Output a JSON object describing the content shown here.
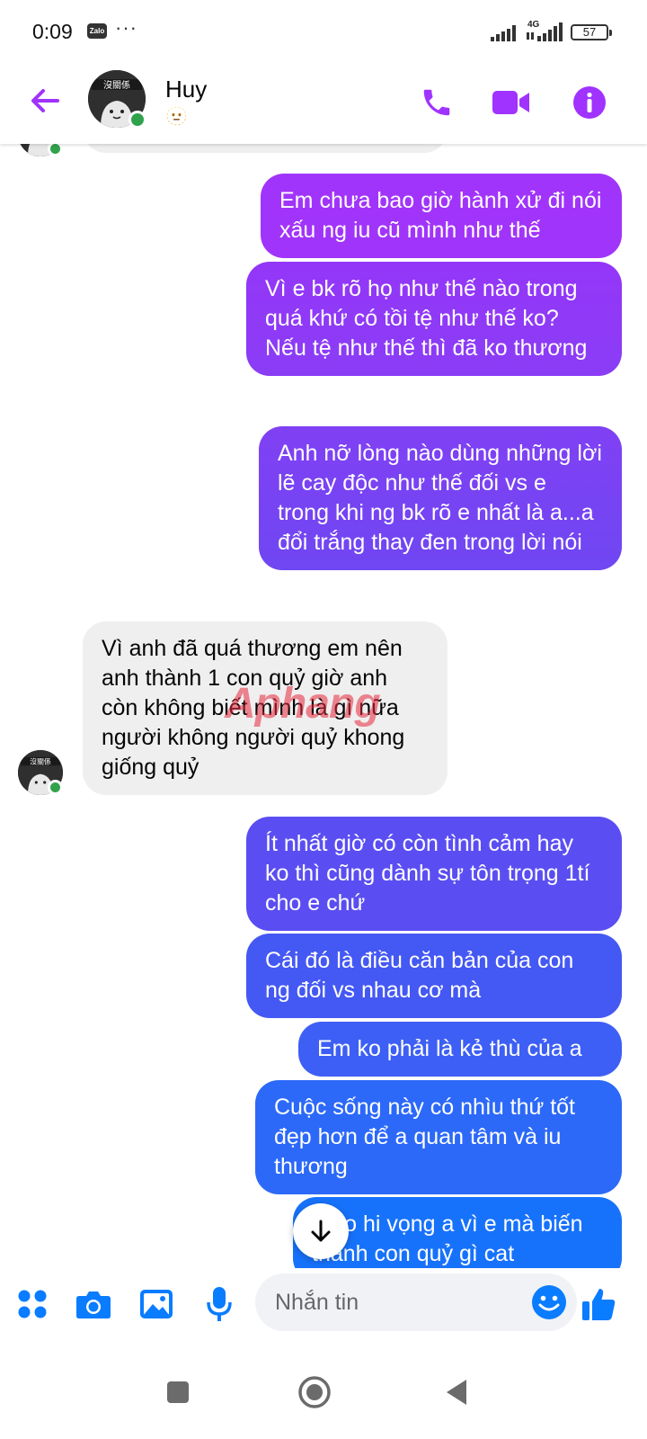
{
  "status_bar": {
    "time": "0:09",
    "app_badge": "Zalo",
    "more": "···",
    "network": "4G",
    "battery": "57"
  },
  "header": {
    "contact_name": "Huy",
    "status_emoji": "🫥"
  },
  "messages": [
    {
      "id": "m1",
      "from": "me",
      "text": "Em chưa bao giờ hành xử đi nói xấu ng iu cũ mình như thế"
    },
    {
      "id": "m2",
      "from": "me",
      "text": "Vì e bk rõ họ như thế nào trong quá khứ có tồi tệ như thế ko? Nếu tệ như thế thì đã ko thương"
    },
    {
      "id": "m3",
      "from": "me",
      "text": "Anh nỡ lòng nào dùng những lời lẽ cay độc như thế đối vs e trong khi ng bk rõ e nhất là a...a đổi trắng thay đen trong lời nói"
    },
    {
      "id": "m4",
      "from": "them",
      "text": "Vì anh đã quá thương em nên anh thành 1 con quỷ giờ anh còn không biết mình là gì nữa người không người quỷ khong giống quỷ"
    },
    {
      "id": "m5",
      "from": "me",
      "text": "Ít nhất giờ có còn tình cảm hay ko thì cũng dành sự tôn trọng 1tí cho e chứ"
    },
    {
      "id": "m6",
      "from": "me",
      "text": "Cái đó là điều căn bản của con ng đối vs nhau cơ mà"
    },
    {
      "id": "m7",
      "from": "me",
      "text": "Em ko phải là kẻ thù của a"
    },
    {
      "id": "m8",
      "from": "me",
      "text": "Cuộc sống này có nhìu thứ tốt đẹp hơn để a quan tâm và iu thương"
    },
    {
      "id": "m9",
      "from": "me",
      "text": "E ko hi vọng a vì e mà biến thành con quỷ gì cat"
    }
  ],
  "watermark": "Aphang",
  "composer": {
    "placeholder": "Nhắn tin"
  },
  "colors": {
    "accent": "#a033ff",
    "gradient_top": "#a334fa",
    "gradient_mid": "#5b4cf0",
    "gradient_bottom": "#0a7cff",
    "online": "#31a24c"
  },
  "icons": {
    "header": [
      "back-arrow-icon",
      "phone-icon",
      "video-camera-icon",
      "info-icon"
    ],
    "composer": [
      "apps-grid-icon",
      "camera-icon",
      "image-icon",
      "microphone-icon",
      "emoji-icon",
      "thumbs-up-icon"
    ],
    "navigation": [
      "recents-icon",
      "home-icon",
      "back-icon"
    ]
  }
}
